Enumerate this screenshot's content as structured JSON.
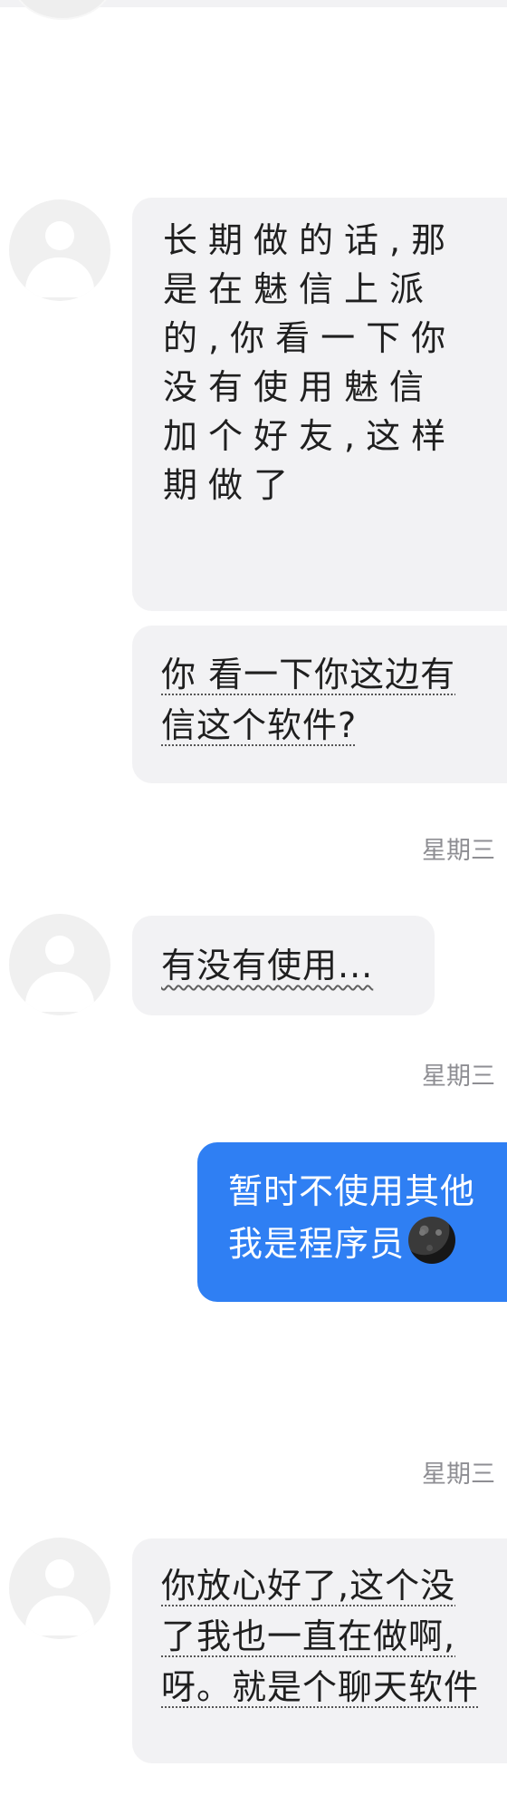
{
  "colors": {
    "background": "#ffffff",
    "incoming_bubble": "#f2f2f4",
    "outgoing_bubble": "#2f7ff3",
    "timestamp": "#8e8e93"
  },
  "conversation": {
    "messages": [
      {
        "direction": "incoming",
        "lines": [
          "长期做的话,那",
          "是在魅信上派",
          "的,你看一下你",
          "没有使用魅信",
          "加个好友,这样",
          "期做了"
        ]
      },
      {
        "direction": "incoming",
        "lines": [
          "你 看一下你这边有",
          "信这个软件?"
        ]
      },
      {
        "direction": "incoming",
        "lines": [
          "有没有使用..."
        ]
      },
      {
        "direction": "outgoing",
        "lines": [
          "暂时不使用其他",
          "我是程序员"
        ],
        "emoji": "new-moon-face-emoji"
      },
      {
        "direction": "incoming",
        "lines": [
          "你放心好了,这个没",
          "了我也一直在做啊,",
          "呀。就是个聊天软件"
        ]
      }
    ],
    "timestamps": [
      "星期三",
      "星期三",
      "星期三"
    ]
  }
}
